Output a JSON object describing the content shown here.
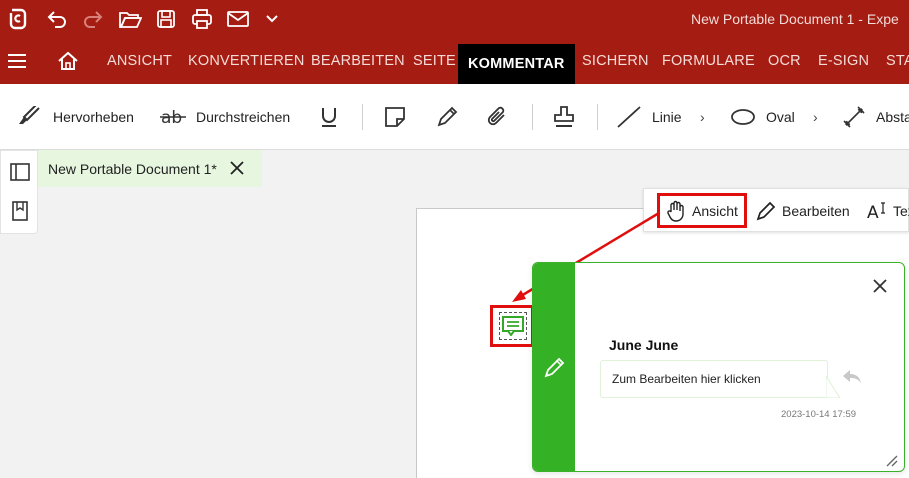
{
  "titlebar": {
    "doc_title": "New Portable Document 1   -   Expe"
  },
  "tabs": [
    {
      "label": "ANSICHT"
    },
    {
      "label": "KONVERTIEREN"
    },
    {
      "label": "BEARBEITEN"
    },
    {
      "label": "SEITE"
    },
    {
      "label": "KOMMENTAR",
      "active": true
    },
    {
      "label": "SICHERN"
    },
    {
      "label": "FORMULARE"
    },
    {
      "label": "OCR"
    },
    {
      "label": "E-SIGN"
    },
    {
      "label": "STA"
    }
  ],
  "toolbar": {
    "highlight_label": "Hervorheben",
    "strikethrough_label": "Durchstreichen",
    "line_label": "Linie",
    "oval_label": "Oval",
    "distance_label": "Absta",
    "chevron": "›"
  },
  "doctab": {
    "name": "New Portable Document 1*"
  },
  "floatbar": {
    "view_label": "Ansicht",
    "edit_label": "Bearbeiten",
    "text_label": "Tex"
  },
  "popup": {
    "author": "June June",
    "placeholder": "Zum Bearbeiten hier klicken",
    "date": "2023-10-14 17:59"
  },
  "colors": {
    "brand_red": "#a51c12",
    "active_tab": "#000000",
    "comment_green": "#35b126",
    "highlight_red": "#e10e0e"
  }
}
